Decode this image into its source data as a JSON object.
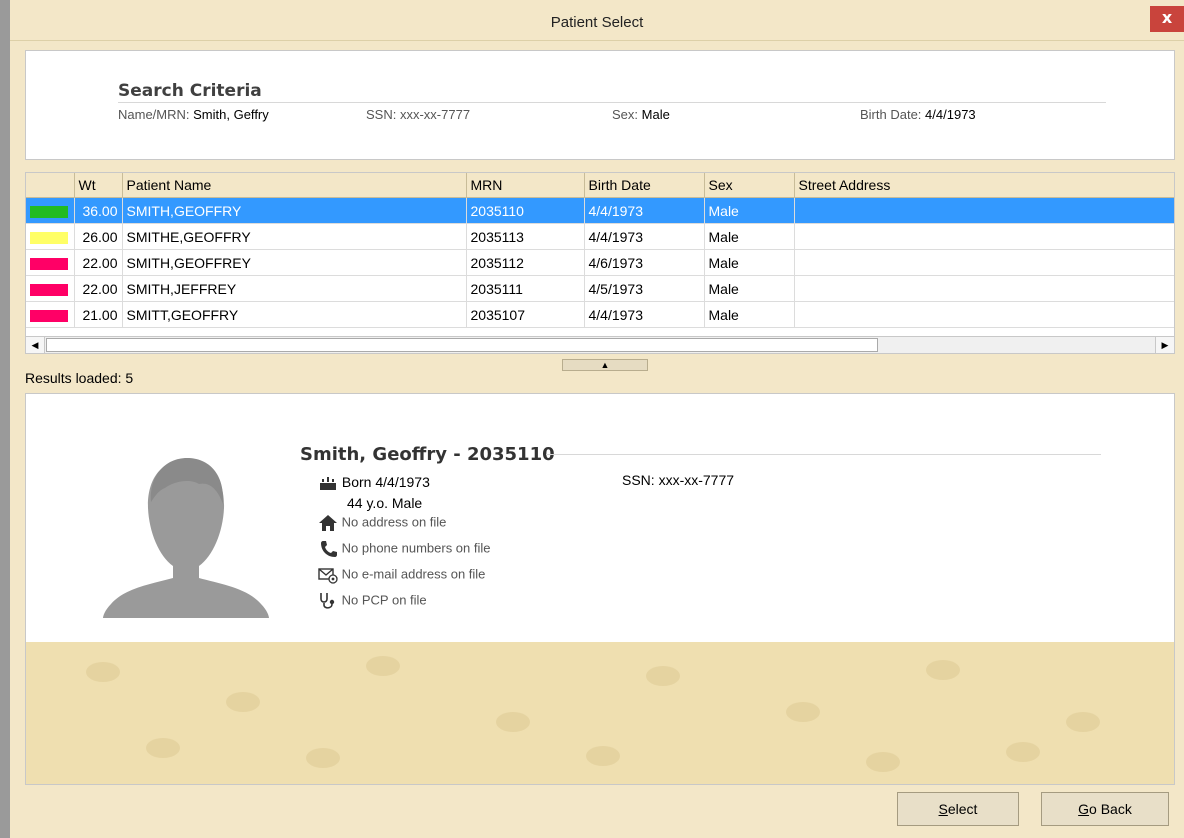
{
  "window": {
    "title": "Patient Select",
    "close_label": "x"
  },
  "criteria": {
    "title": "Search Criteria",
    "name_label": "Name/MRN:",
    "name_value": "Smith, Geffry",
    "ssn_label": "SSN:",
    "ssn_value": "xxx-xx-7777",
    "sex_label": "Sex:",
    "sex_value": "Male",
    "birth_label": "Birth Date:",
    "birth_value": "4/4/1973"
  },
  "grid": {
    "columns": [
      "",
      "Wt",
      "Patient Name",
      "MRN",
      "Birth Date",
      "Sex",
      "Street Address"
    ],
    "rows": [
      {
        "color": "#22bb22",
        "wt": "36.00",
        "name": "SMITH,GEOFFRY",
        "mrn": "2035110",
        "birth": "4/4/1973",
        "sex": "Male",
        "address": ""
      },
      {
        "color": "#ffff66",
        "wt": "26.00",
        "name": "SMITHE,GEOFFRY",
        "mrn": "2035113",
        "birth": "4/4/1973",
        "sex": "Male",
        "address": ""
      },
      {
        "color": "#ff0066",
        "wt": "22.00",
        "name": "SMITH,GEOFFREY",
        "mrn": "2035112",
        "birth": "4/6/1973",
        "sex": "Male",
        "address": ""
      },
      {
        "color": "#ff0066",
        "wt": "22.00",
        "name": "SMITH,JEFFREY",
        "mrn": "2035111",
        "birth": "4/5/1973",
        "sex": "Male",
        "address": ""
      },
      {
        "color": "#ff0066",
        "wt": "21.00",
        "name": "SMITT,GEOFFRY",
        "mrn": "2035107",
        "birth": "4/4/1973",
        "sex": "Male",
        "address": ""
      }
    ],
    "selected_index": 0
  },
  "status": {
    "results_text": "Results loaded: 5"
  },
  "detail": {
    "name_line": "Smith, Geoffry - 2035110",
    "born": "Born 4/4/1973",
    "age_sex": "44 y.o. Male",
    "ssn": "SSN: xxx-xx-7777",
    "address": "No address on file",
    "phone": "No phone numbers on file",
    "email": "No e-mail address on file",
    "pcp": "No PCP on file"
  },
  "buttons": {
    "select_mnemonic": "S",
    "select_rest": "elect",
    "goback_mnemonic": "G",
    "goback_rest": "o Back"
  },
  "colors": {
    "selection": "#3399ff",
    "chrome": "#f3e7c8"
  }
}
